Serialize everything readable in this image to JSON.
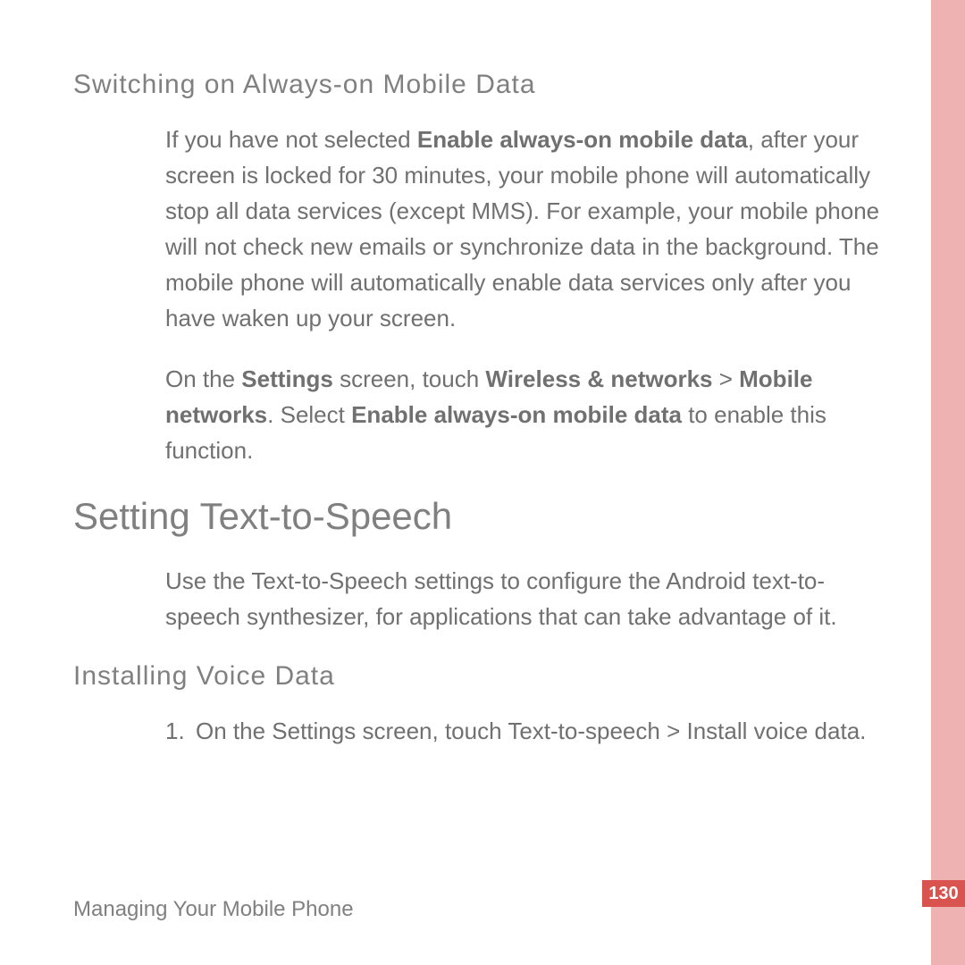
{
  "s1": {
    "heading": "Switching on Always-on Mobile Data",
    "p1": {
      "t1": "If you have not selected ",
      "b1": "Enable always-on mobile data",
      "t2": ", after your screen is locked for 30 minutes, your mobile phone will automatically stop all data services (except MMS). For example, your mobile phone will not check new emails or synchronize data in the background. The mobile phone will automatically enable data services only after you have waken up your screen."
    },
    "p2": {
      "t1": "On the ",
      "b1": "Settings",
      "t2": " screen, touch ",
      "b2": "Wireless & networks",
      "t3": " > ",
      "b3": "Mobile networks",
      "t4": ". Select ",
      "b4": "Enable always-on mobile data",
      "t5": " to enable this function."
    }
  },
  "s2": {
    "heading": "Setting Text-to-Speech",
    "p1": "Use the Text-to-Speech settings to configure the Android text-to-speech synthesizer, for applications that can take advantage of it."
  },
  "s3": {
    "heading": "Installing Voice Data",
    "item1": {
      "num": "1.",
      "t1": "On the ",
      "b1": "Settings",
      "t2": " screen, touch ",
      "b2": "Text-to-speech",
      "t3": " > ",
      "b3": "Install voice data",
      "t4": "."
    }
  },
  "footer": {
    "chapter": "Managing Your Mobile Phone",
    "page": "130"
  }
}
